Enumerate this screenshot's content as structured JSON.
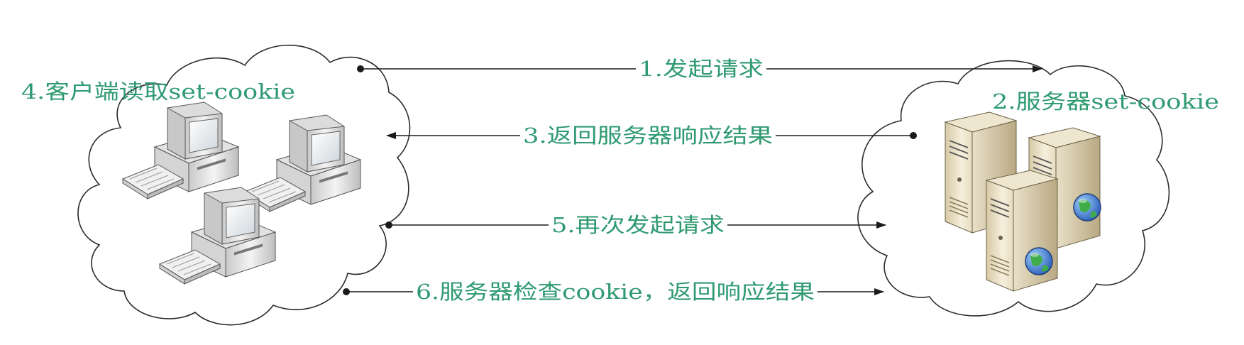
{
  "labels": {
    "client_read": "4.客户端读取set-cookie",
    "server_set": "2.服务器set-cookie"
  },
  "arrows": [
    {
      "label": "1.发起请求",
      "direction": "right"
    },
    {
      "label": "3.返回服务器响应结果",
      "direction": "left"
    },
    {
      "label": "5.再次发起请求",
      "direction": "right"
    },
    {
      "label": "6.服务器检查cookie，返回响应结果",
      "direction": "right"
    }
  ],
  "colors": {
    "label_text": "#2f9a72",
    "line": "#1a1a1a",
    "cloud_stroke": "#2b2b2b",
    "globe": "#3a7bd5"
  },
  "icons": [
    "computer-icon",
    "server-icon",
    "globe-icon",
    "cloud-shape"
  ]
}
